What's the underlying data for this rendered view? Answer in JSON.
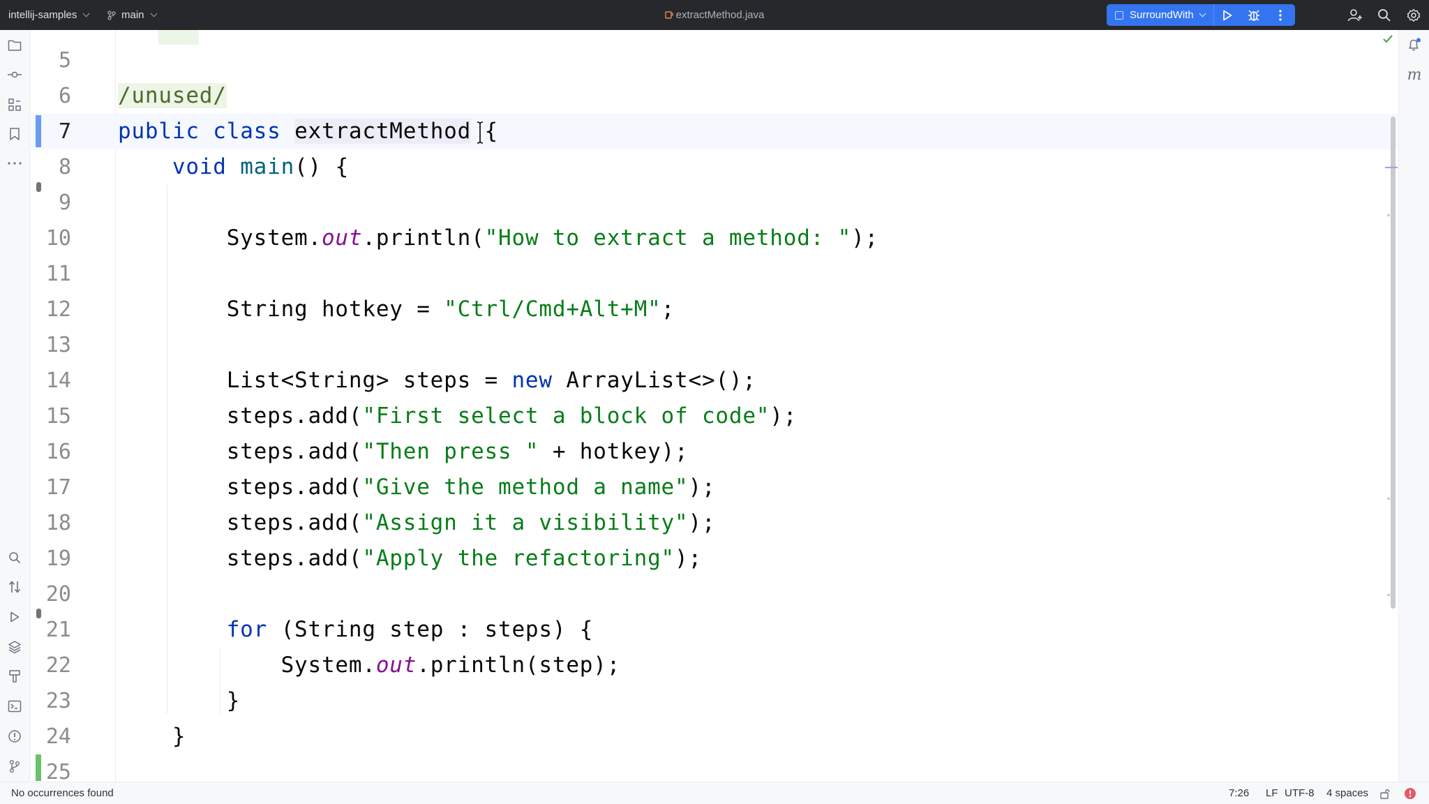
{
  "titlebar": {
    "project": "intellij-samples",
    "branch": "main",
    "file": "extractMethod.java",
    "run_config": "SurroundWith"
  },
  "editor": {
    "lines": [
      {
        "num": "5"
      },
      {
        "num": "6"
      },
      {
        "num": "7"
      },
      {
        "num": "8"
      },
      {
        "num": "9"
      },
      {
        "num": "10"
      },
      {
        "num": "11"
      },
      {
        "num": "12"
      },
      {
        "num": "13"
      },
      {
        "num": "14"
      },
      {
        "num": "15"
      },
      {
        "num": "16"
      },
      {
        "num": "17"
      },
      {
        "num": "18"
      },
      {
        "num": "19"
      },
      {
        "num": "20"
      },
      {
        "num": "21"
      },
      {
        "num": "22"
      },
      {
        "num": "23"
      },
      {
        "num": "24"
      },
      {
        "num": "25"
      }
    ],
    "tokens": {
      "unused": "/unused/",
      "public": "public",
      "class": "class",
      "class_name": "extractMethod",
      "open_brace": " {",
      "void": "void",
      "main": "main",
      "main_rest": "() {",
      "system": "System.",
      "out": "out",
      "println": ".println(",
      "str_howto": "\"How to extract a method: \"",
      "close_paren_semi": ");",
      "string_hotkey": "String hotkey = ",
      "str_hotkey": "\"Ctrl/Cmd+Alt+M\"",
      "semi": ";",
      "list_decl": "List<String> steps = ",
      "new": "new",
      "arraylist": " ArrayList<>();",
      "steps_add": "steps.add(",
      "str_step1": "\"First select a block of code\"",
      "str_step2": "\"Then press \"",
      "plus_hotkey": " + hotkey);",
      "str_step3": "\"Give the method a name\"",
      "str_step4": "\"Assign it a visibility\"",
      "str_step5": "\"Apply the refactoring\"",
      "for": "for",
      "for_rest": " (String step : steps) {",
      "println_step": ".println(step);",
      "close_brace": "}"
    }
  },
  "statusbar": {
    "message": "No occurrences found",
    "position": "7:26",
    "line_ending": "LF",
    "encoding": "UTF-8",
    "indent": "4 spaces"
  },
  "colors": {
    "accent": "#3574f0",
    "keyword": "#0033b3",
    "string": "#067d17",
    "field": "#871094",
    "change_marker": "#6bc06b",
    "error": "#e55765"
  }
}
